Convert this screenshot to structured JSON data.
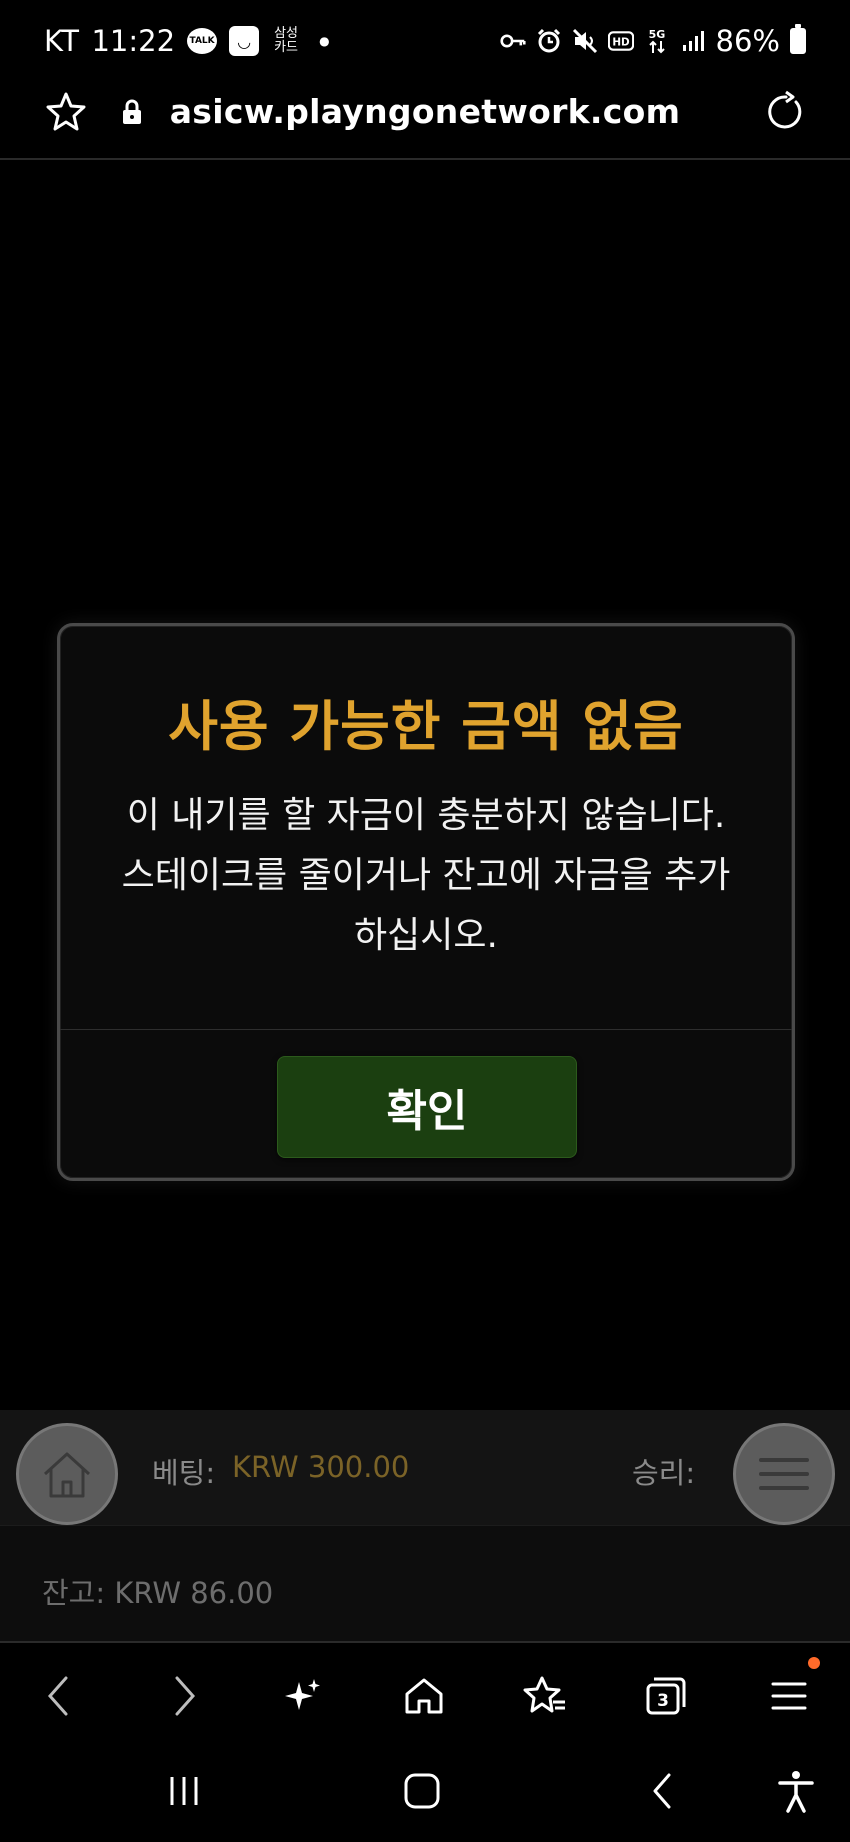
{
  "status_bar": {
    "carrier": "KT",
    "time": "11:22",
    "talk_badge": "TALK",
    "samsung_card": "삼성\n카드",
    "battery": "86%"
  },
  "url_bar": {
    "url": "asicw.playngonetwork.com"
  },
  "modal": {
    "title": "사용 가능한 금액 없음",
    "message_line1": "이 내기를 할 자금이 충분하지 않습니다.",
    "message_line2": "스테이크를 줄이거나 잔고에 자금을 추가",
    "message_line3": "하십시오.",
    "ok_label": "확인"
  },
  "game_bar": {
    "bet_label": "베팅:",
    "bet_value": "KRW 300.00",
    "win_label": "승리:"
  },
  "balance": {
    "text": "잔고: KRW 86.00"
  },
  "browser_nav": {
    "tabs_count": "3"
  },
  "colors": {
    "title_gold": "#e0a32e",
    "ok_green": "#1b3f10",
    "bet_value": "#7b6327",
    "notification": "#ff6a2a"
  },
  "icons": [
    "talk-icon",
    "shopping-bag-icon",
    "key-icon",
    "alarm-icon",
    "mute-icon",
    "hd-icon",
    "5g-icon",
    "signal-icon",
    "battery-icon",
    "star-icon",
    "lock-icon",
    "reload-icon",
    "home-icon",
    "menu-icon",
    "back-icon",
    "forward-icon",
    "sparkle-icon",
    "bookmarks-icon",
    "tabs-icon",
    "more-icon",
    "recents-icon",
    "accessibility-icon"
  ]
}
